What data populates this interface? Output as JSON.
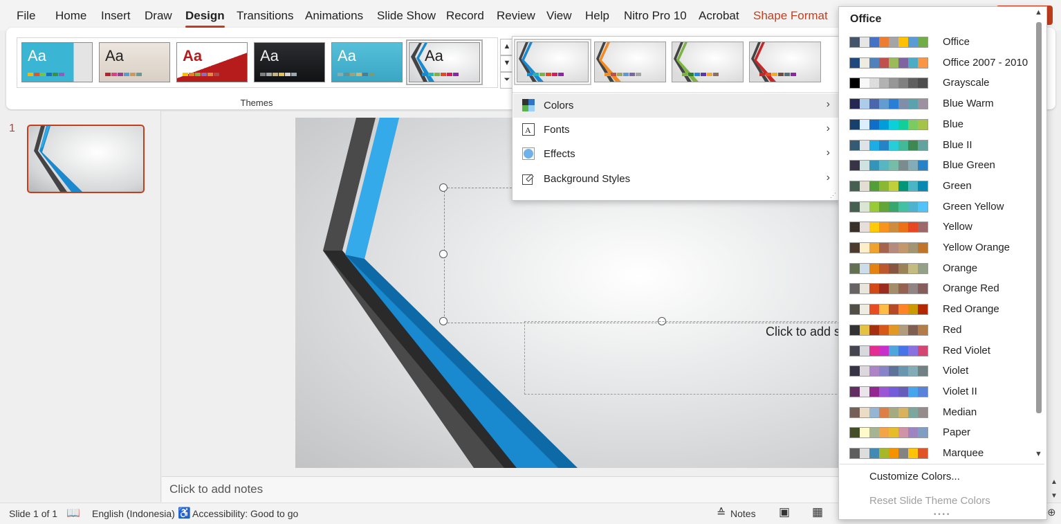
{
  "menubar": {
    "items": [
      "File",
      "Home",
      "Insert",
      "Draw",
      "Design",
      "Transitions",
      "Animations",
      "Slide Show",
      "Record",
      "Review",
      "View",
      "Help",
      "Nitro Pro 10",
      "Acrobat",
      "Shape Format"
    ],
    "active": "Design"
  },
  "ribbon": {
    "themes_label": "Themes",
    "theme_thumb_text": "Aa"
  },
  "slides_pane": {
    "slide_number": "1"
  },
  "slide": {
    "subtitle_placeholder": "Click to add s"
  },
  "notes": {
    "placeholder": "Click to add notes"
  },
  "design_menu": {
    "items": [
      {
        "label": "Colors",
        "icon": "colors-icon"
      },
      {
        "label": "Fonts",
        "icon": "fonts-icon"
      },
      {
        "label": "Effects",
        "icon": "effects-icon"
      },
      {
        "label": "Background Styles",
        "icon": "background-styles-icon"
      }
    ]
  },
  "colors_menu": {
    "header": "Office",
    "palettes": [
      {
        "name": "Office",
        "colors": [
          "#44546a",
          "#e7e6e6",
          "#4472c4",
          "#ed7d31",
          "#a5a5a5",
          "#ffc000",
          "#5b9bd5",
          "#70ad47"
        ]
      },
      {
        "name": "Office 2007 - 2010",
        "colors": [
          "#1f497d",
          "#eeece1",
          "#4f81bd",
          "#c0504d",
          "#9bbb59",
          "#8064a2",
          "#4bacc6",
          "#f79646"
        ]
      },
      {
        "name": "Grayscale",
        "colors": [
          "#000000",
          "#f8f8f8",
          "#dddddd",
          "#b2b2b2",
          "#969696",
          "#808080",
          "#5f5f5f",
          "#4d4d4d"
        ]
      },
      {
        "name": "Blue Warm",
        "colors": [
          "#242852",
          "#acccea",
          "#4a66ac",
          "#629dd1",
          "#297fd5",
          "#7f8fa9",
          "#5aa2ae",
          "#9d90a0"
        ]
      },
      {
        "name": "Blue",
        "colors": [
          "#17406d",
          "#dbefff",
          "#0f6fc6",
          "#009dd9",
          "#0bd0d9",
          "#10cf9b",
          "#7cca62",
          "#a5c249"
        ]
      },
      {
        "name": "Blue II",
        "colors": [
          "#335b74",
          "#dfe3e5",
          "#1cade4",
          "#2683c6",
          "#27ced7",
          "#42ba97",
          "#3e8853",
          "#62a39f"
        ]
      },
      {
        "name": "Blue Green",
        "colors": [
          "#373545",
          "#cee2e2",
          "#3494ba",
          "#58b6c0",
          "#75bda7",
          "#7a8c8e",
          "#84acb6",
          "#2683c6"
        ]
      },
      {
        "name": "Green",
        "colors": [
          "#455f51",
          "#e3ded1",
          "#549e39",
          "#8ab833",
          "#c0cf3a",
          "#029676",
          "#4ab5c4",
          "#0989b1"
        ]
      },
      {
        "name": "Green Yellow",
        "colors": [
          "#455f51",
          "#dbe5d3",
          "#99cb38",
          "#63a537",
          "#37a76f",
          "#44c1a3",
          "#4eb3cf",
          "#51c3f9"
        ]
      },
      {
        "name": "Yellow",
        "colors": [
          "#39302a",
          "#e5dedb",
          "#ffca08",
          "#f8931d",
          "#ce8d3e",
          "#ec7016",
          "#e64823",
          "#9c6a6a"
        ]
      },
      {
        "name": "Yellow Orange",
        "colors": [
          "#4e3b30",
          "#fbeec9",
          "#f0a22e",
          "#a5644e",
          "#b58b80",
          "#c3986d",
          "#a19574",
          "#c17529"
        ]
      },
      {
        "name": "Orange",
        "colors": [
          "#637052",
          "#ccddea",
          "#e48312",
          "#bd582c",
          "#865640",
          "#9b8357",
          "#c2bc80",
          "#94a088"
        ]
      },
      {
        "name": "Orange Red",
        "colors": [
          "#696464",
          "#e9e5dc",
          "#d34817",
          "#9b2d1f",
          "#a28e6a",
          "#956251",
          "#918485",
          "#855d5d"
        ]
      },
      {
        "name": "Red Orange",
        "colors": [
          "#505046",
          "#eeece1",
          "#e84c22",
          "#ffbd47",
          "#b64926",
          "#ff8427",
          "#cc9900",
          "#b22600"
        ]
      },
      {
        "name": "Red",
        "colors": [
          "#323232",
          "#e5c243",
          "#a5300f",
          "#d55816",
          "#e19825",
          "#b19c7d",
          "#7f5f52",
          "#b27d49"
        ]
      },
      {
        "name": "Red Violet",
        "colors": [
          "#454551",
          "#d8d9dc",
          "#e32d91",
          "#c830cc",
          "#4ea6dc",
          "#4775e7",
          "#8971e1",
          "#d54773"
        ]
      },
      {
        "name": "Violet",
        "colors": [
          "#373545",
          "#dcd8dc",
          "#ad84c6",
          "#8784c7",
          "#5d739a",
          "#6997af",
          "#84acb6",
          "#6f8183"
        ]
      },
      {
        "name": "Violet II",
        "colors": [
          "#632e62",
          "#eae5eb",
          "#92278f",
          "#9b57d3",
          "#755dd9",
          "#665eb8",
          "#45a5ed",
          "#5982db"
        ]
      },
      {
        "name": "Median",
        "colors": [
          "#775f55",
          "#ebddc3",
          "#94b6d2",
          "#dd8047",
          "#a5ab81",
          "#d8b25c",
          "#7ba79d",
          "#968c8c"
        ]
      },
      {
        "name": "Paper",
        "colors": [
          "#444d26",
          "#fefac9",
          "#a5b592",
          "#f3a447",
          "#e7bc29",
          "#d092a7",
          "#9c85c0",
          "#809ec2"
        ]
      },
      {
        "name": "Marquee",
        "colors": [
          "#5e5e5e",
          "#dddddd",
          "#418ab3",
          "#a6b727",
          "#f69200",
          "#838383",
          "#fec306",
          "#df5327"
        ]
      }
    ],
    "customize": "Customize Colors...",
    "reset": "Reset Slide Theme Colors"
  },
  "statusbar": {
    "slide_info": "Slide 1 of 1",
    "language": "English (Indonesia)",
    "accessibility": "Accessibility: Good to go",
    "notes": "Notes"
  },
  "colors": {
    "accent": "#c43e1c",
    "blue": "#1a8ad0",
    "dark_stripe": "#3a3a3a"
  }
}
